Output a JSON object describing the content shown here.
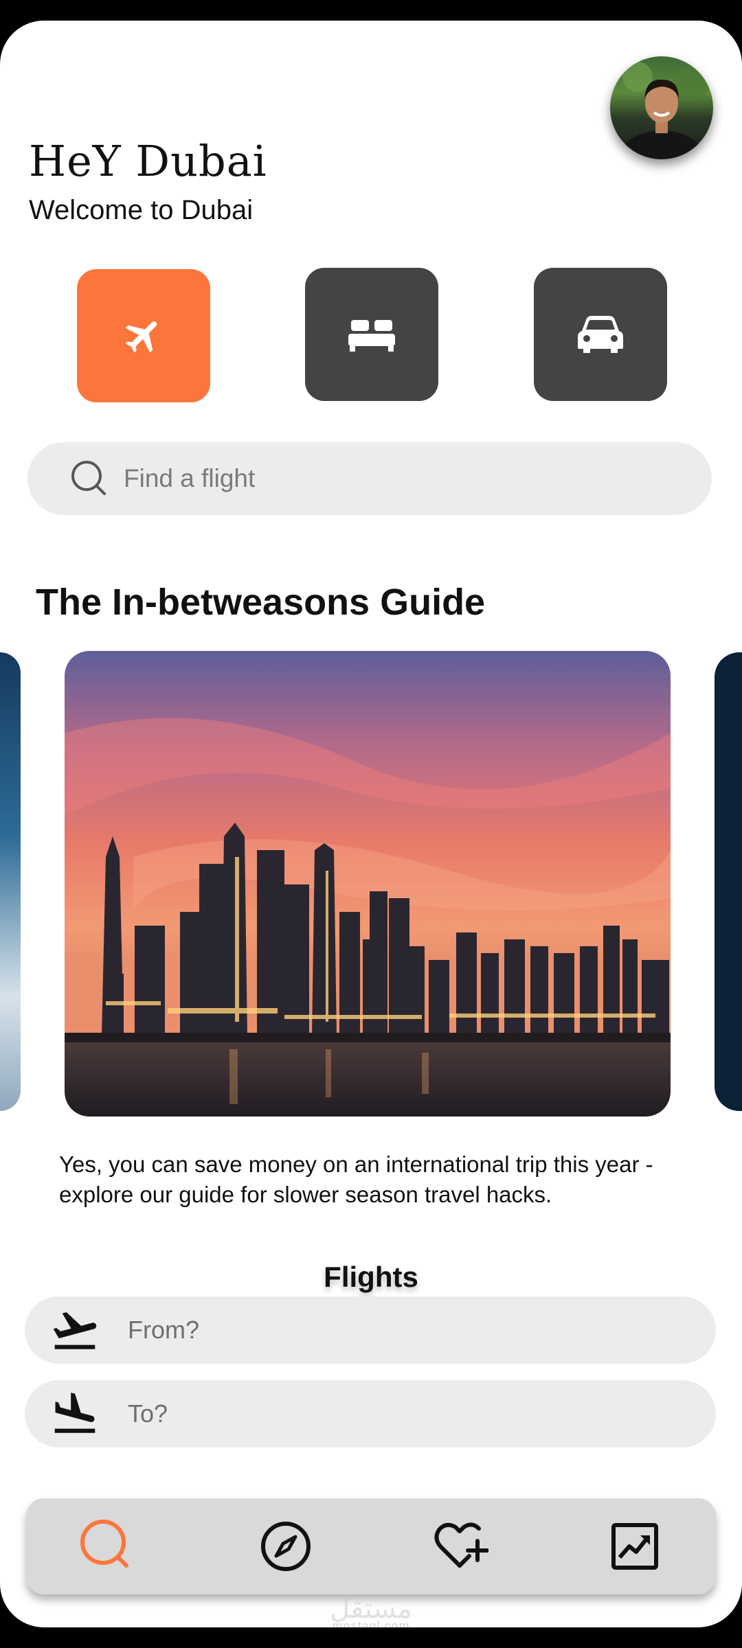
{
  "header": {
    "title": "HeY Dubai",
    "subtitle": "Welcome to Dubai",
    "avatar_icon": "user-avatar"
  },
  "categories": [
    {
      "id": "flights",
      "icon": "airplane-icon",
      "active": true
    },
    {
      "id": "hotels",
      "icon": "bed-icon",
      "active": false
    },
    {
      "id": "cars",
      "icon": "car-icon",
      "active": false
    }
  ],
  "search": {
    "placeholder": "Find a flight"
  },
  "guide": {
    "title": "The In-betweasons Guide",
    "description": "Yes, you can save money on an international trip this year - explore our guide for slower season travel hacks."
  },
  "flights": {
    "title": "Flights",
    "from_placeholder": "From?",
    "to_placeholder": "To?"
  },
  "nav": [
    {
      "id": "search",
      "icon": "search-icon",
      "active": true
    },
    {
      "id": "explore",
      "icon": "compass-icon",
      "active": false
    },
    {
      "id": "favorites",
      "icon": "heart-plus-icon",
      "active": false
    },
    {
      "id": "trends",
      "icon": "trending-chart-icon",
      "active": false
    }
  ],
  "watermark": {
    "arabic": "مستقل",
    "latin": "mostaql.com"
  },
  "colors": {
    "accent": "#FC763C",
    "dark_tile": "#444444",
    "field_bg": "#ECECEC",
    "nav_bg": "#D9D9D9"
  }
}
